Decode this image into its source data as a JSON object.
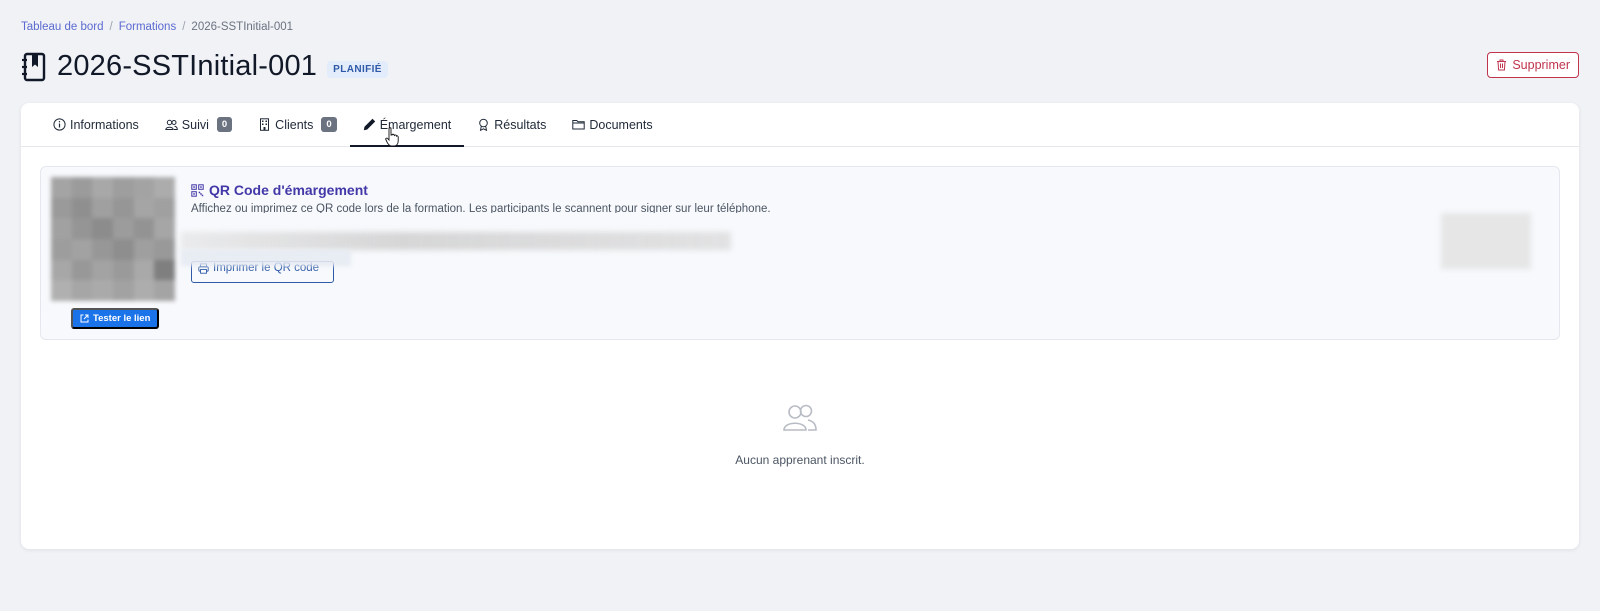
{
  "breadcrumb": {
    "items": [
      "Tableau de bord",
      "Formations",
      "2026-SSTInitial-001"
    ],
    "separator": "/"
  },
  "header": {
    "title": "2026-SSTInitial-001",
    "status": "PLANIFIÉ",
    "delete_label": "Supprimer"
  },
  "tabs": [
    {
      "label": "Informations",
      "icon": "info-icon"
    },
    {
      "label": "Suivi",
      "icon": "users-icon",
      "count": "0"
    },
    {
      "label": "Clients",
      "icon": "building-icon",
      "count": "0"
    },
    {
      "label": "Émargement",
      "icon": "pencil-icon",
      "active": true
    },
    {
      "label": "Résultats",
      "icon": "award-icon"
    },
    {
      "label": "Documents",
      "icon": "folder-icon"
    }
  ],
  "qr": {
    "title": "QR Code d'émargement",
    "description": "Affichez ou imprimez ce QR code lors de la formation. Les participants le scannent pour signer sur leur téléphone.",
    "print_label": "Imprimer le QR code",
    "test_link_label": "Tester le lien"
  },
  "empty_state": {
    "icon": "users-icon",
    "text": "Aucun apprenant inscrit."
  },
  "colors": {
    "accent": "#4338a8",
    "primary_blue": "#1a73e8",
    "danger": "#c0344d",
    "badge_bg": "#e3ecfb"
  }
}
